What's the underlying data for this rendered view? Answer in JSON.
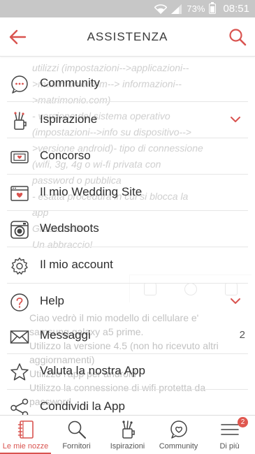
{
  "status_bar": {
    "battery": "73%",
    "time": "08:51"
  },
  "header": {
    "title": "ASSISTENZA"
  },
  "background_text": {
    "question_lines": [
      "utilizzi (impostazioni-->applicazioni--",
      ">matrimonio.com--> informazioni--",
      ">matrimonio.com)",
      "- versione del sistema operativo",
      "(impostazioni-->info su dispositivo-->",
      ">versione android)- tipo di connessione",
      "(wifi, 3g, 4g o wi-fi privata con",
      "password o pubblica",
      "- esatta procedura in cui si blocca la",
      "app",
      "Grazie mille!",
      "Un abbraccio!"
    ],
    "reply_lines": [
      "Ciao vedrò il mio modello di cellulare e'",
      "samsung galaxy a5 prime.",
      "Utilizzo la versione 4.5 (non ho ricevuto altri",
      "aggiornamenti)",
      "Utilizzo l'app per android",
      "Utilizzo la connessione di wifi protetta da",
      "password"
    ]
  },
  "menu": {
    "items": [
      {
        "label": "Community",
        "icon": "chat-bubble-icon",
        "chevron": false,
        "count": ""
      },
      {
        "label": "Ispirazione",
        "icon": "brush-jar-icon",
        "chevron": true,
        "count": ""
      },
      {
        "label": "Concorso",
        "icon": "ticket-icon",
        "chevron": false,
        "count": ""
      },
      {
        "label": "Il mio Wedding Site",
        "icon": "website-heart-icon",
        "chevron": false,
        "count": ""
      },
      {
        "label": "Wedshoots",
        "icon": "camera-icon",
        "chevron": false,
        "count": ""
      },
      {
        "label": "Il mio account",
        "icon": "gear-icon",
        "chevron": false,
        "count": ""
      },
      {
        "label": "Help",
        "icon": "help-circle-icon",
        "chevron": true,
        "count": ""
      },
      {
        "label": "Messaggi",
        "icon": "envelope-icon",
        "chevron": false,
        "count": "2"
      },
      {
        "label": "Valuta la nostra App",
        "icon": "star-icon",
        "chevron": false,
        "count": ""
      },
      {
        "label": "Condividi la App",
        "icon": "share-icon",
        "chevron": false,
        "count": ""
      }
    ]
  },
  "bottom_nav": {
    "items": [
      {
        "label": "Le mie nozze",
        "icon": "notebook-icon",
        "active": true,
        "badge": ""
      },
      {
        "label": "Fornitori",
        "icon": "search-icon",
        "active": false,
        "badge": ""
      },
      {
        "label": "Ispirazioni",
        "icon": "brush-jar-icon",
        "active": false,
        "badge": ""
      },
      {
        "label": "Community",
        "icon": "heart-chat-icon",
        "active": false,
        "badge": ""
      },
      {
        "label": "Di più",
        "icon": "hamburger-icon",
        "active": false,
        "badge": "2"
      }
    ]
  },
  "colors": {
    "accent": "#d9534f",
    "icon_stroke": "#444444",
    "ghost_text": "#cfcfcf"
  }
}
